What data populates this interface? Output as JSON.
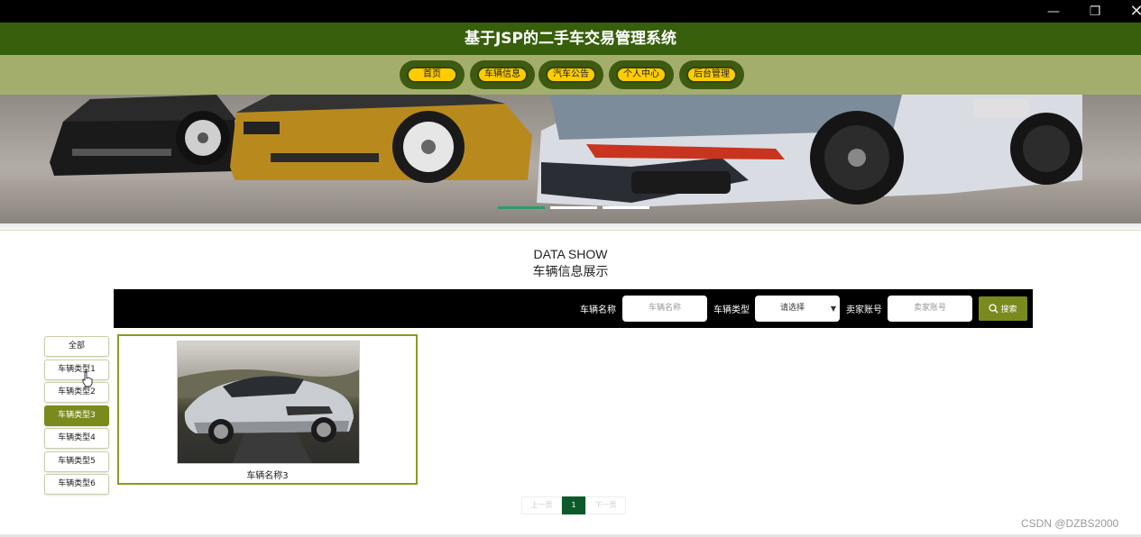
{
  "window": {
    "minimize_icon": "minimize-icon",
    "restore_icon": "restore-icon",
    "close_icon": "close-icon"
  },
  "header": {
    "title": "基于JSP的二手车交易管理系统",
    "bg_color": "#385f0c"
  },
  "nav": {
    "items": [
      {
        "label": "首页"
      },
      {
        "label": "车辆信息"
      },
      {
        "label": "汽车公告"
      },
      {
        "label": "个人中心"
      },
      {
        "label": "后台管理"
      }
    ],
    "bg_color": "#a3ae6c",
    "pill_color": "#ffcc00"
  },
  "banner": {
    "slide_count": 3,
    "active_slide": 1,
    "indicator_color": "#2f9a6a"
  },
  "section": {
    "title_en": "DATA SHOW",
    "title_cn": "车辆信息展示"
  },
  "search": {
    "name_label": "车辆名称",
    "name_placeholder": "车辆名称",
    "type_label": "车辆类型",
    "type_selected": "请选择",
    "seller_label": "卖家账号",
    "seller_placeholder": "卖家账号",
    "button_label": "搜索",
    "button_color": "#7b8a1c"
  },
  "categories": {
    "items": [
      "全部",
      "车辆类型1",
      "车辆类型2",
      "车辆类型3",
      "车辆类型4",
      "车辆类型5",
      "车辆类型6"
    ],
    "active_index": 3
  },
  "cards": [
    {
      "name": "车辆名称3"
    }
  ],
  "pagination": {
    "prev": "上一页",
    "current": "1",
    "next": "下一页"
  },
  "watermark": "CSDN @DZBS2000"
}
